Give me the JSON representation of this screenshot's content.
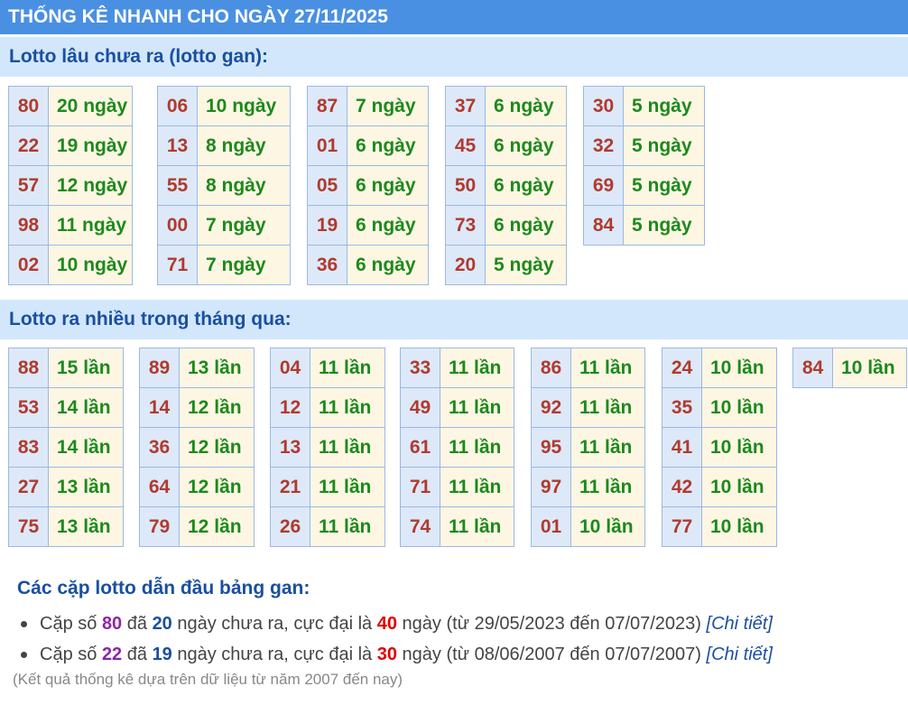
{
  "header": {
    "title": "THỐNG KÊ NHANH CHO NGÀY 27/11/2025"
  },
  "gan_section": {
    "title": "Lotto lâu chưa ra (lotto gan):",
    "columns": [
      [
        {
          "num": "80",
          "val": "20 ngày"
        },
        {
          "num": "22",
          "val": "19 ngày"
        },
        {
          "num": "57",
          "val": "12 ngày"
        },
        {
          "num": "98",
          "val": "11 ngày"
        },
        {
          "num": "02",
          "val": "10 ngày"
        }
      ],
      [
        {
          "num": "06",
          "val": "10 ngày"
        },
        {
          "num": "13",
          "val": "8 ngày"
        },
        {
          "num": "55",
          "val": "8 ngày"
        },
        {
          "num": "00",
          "val": "7 ngày"
        },
        {
          "num": "71",
          "val": "7 ngày"
        }
      ],
      [
        {
          "num": "87",
          "val": "7 ngày"
        },
        {
          "num": "01",
          "val": "6 ngày"
        },
        {
          "num": "05",
          "val": "6 ngày"
        },
        {
          "num": "19",
          "val": "6 ngày"
        },
        {
          "num": "36",
          "val": "6 ngày"
        }
      ],
      [
        {
          "num": "37",
          "val": "6 ngày"
        },
        {
          "num": "45",
          "val": "6 ngày"
        },
        {
          "num": "50",
          "val": "6 ngày"
        },
        {
          "num": "73",
          "val": "6 ngày"
        },
        {
          "num": "20",
          "val": "5 ngày"
        }
      ],
      [
        {
          "num": "30",
          "val": "5 ngày"
        },
        {
          "num": "32",
          "val": "5 ngày"
        },
        {
          "num": "69",
          "val": "5 ngày"
        },
        {
          "num": "84",
          "val": "5 ngày"
        }
      ]
    ]
  },
  "freq_section": {
    "title": "Lotto ra nhiều trong tháng qua:",
    "columns": [
      [
        {
          "num": "88",
          "val": "15 lần"
        },
        {
          "num": "53",
          "val": "14 lần"
        },
        {
          "num": "83",
          "val": "14 lần"
        },
        {
          "num": "27",
          "val": "13 lần"
        },
        {
          "num": "75",
          "val": "13 lần"
        }
      ],
      [
        {
          "num": "89",
          "val": "13 lần"
        },
        {
          "num": "14",
          "val": "12 lần"
        },
        {
          "num": "36",
          "val": "12 lần"
        },
        {
          "num": "64",
          "val": "12 lần"
        },
        {
          "num": "79",
          "val": "12 lần"
        }
      ],
      [
        {
          "num": "04",
          "val": "11 lần"
        },
        {
          "num": "12",
          "val": "11 lần"
        },
        {
          "num": "13",
          "val": "11 lần"
        },
        {
          "num": "21",
          "val": "11 lần"
        },
        {
          "num": "26",
          "val": "11 lần"
        }
      ],
      [
        {
          "num": "33",
          "val": "11 lần"
        },
        {
          "num": "49",
          "val": "11 lần"
        },
        {
          "num": "61",
          "val": "11 lần"
        },
        {
          "num": "71",
          "val": "11 lần"
        },
        {
          "num": "74",
          "val": "11 lần"
        }
      ],
      [
        {
          "num": "86",
          "val": "11 lần"
        },
        {
          "num": "92",
          "val": "11 lần"
        },
        {
          "num": "95",
          "val": "11 lần"
        },
        {
          "num": "97",
          "val": "11 lần"
        },
        {
          "num": "01",
          "val": "10 lần"
        }
      ],
      [
        {
          "num": "24",
          "val": "10 lần"
        },
        {
          "num": "35",
          "val": "10 lần"
        },
        {
          "num": "41",
          "val": "10 lần"
        },
        {
          "num": "42",
          "val": "10 lần"
        },
        {
          "num": "77",
          "val": "10 lần"
        }
      ],
      [
        {
          "num": "84",
          "val": "10 lần"
        }
      ]
    ]
  },
  "lead_pairs": {
    "title": "Các cặp lotto dẫn đầu bảng gan:",
    "items": [
      {
        "prefix": "Cặp số",
        "number": "80",
        "da": "đã",
        "days": "20",
        "mid": "ngày chưa ra, cực đại là",
        "max": "40",
        "range": "ngày (từ 29/05/2023 đến 07/07/2023)",
        "link": "[Chi tiết]"
      },
      {
        "prefix": "Cặp số",
        "number": "22",
        "da": "đã",
        "days": "19",
        "mid": "ngày chưa ra, cực đại là",
        "max": "30",
        "range": "ngày (từ 08/06/2007 đến 07/07/2007)",
        "link": "[Chi tiết]"
      }
    ]
  },
  "footnote": "(Kết quả thống kê dựa trên dữ liệu từ năm 2007 đến nay)"
}
